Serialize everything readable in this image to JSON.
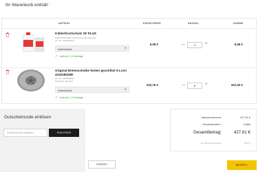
{
  "page": {
    "title": "Ihr Warenkorb enthält :"
  },
  "table": {
    "headers": {
      "artikel": "ARTIKEL",
      "einzelpreis": "EINZELPREIS",
      "anzahl": "ANZAHL",
      "summe": "SUMME"
    }
  },
  "items": [
    {
      "name": "Kühlerfrostschutz SF PLUS",
      "meta1": "Kühlerfrostschutz SF PLUS (1,5ltr-Flasche)",
      "meta2": "Art.-Nr.: SF00374A1",
      "attributes_label": "Artikeldetails",
      "stock": "Lieferzeit: 1-2 Werktage",
      "unit_price": "6,09 €",
      "quantity": "1",
      "total": "6,09 €"
    },
    {
      "name": "Original Bremsscheibe hinten geschlitzt 5-Loch 432028026R",
      "meta1": "Art.-Nr.: SF0003A01",
      "meta2": "Hersteller: Renault",
      "attributes_label": "Artikeldetails",
      "stock": "Lieferzeit: 1-2 Werktage",
      "unit_price": "210,76 €",
      "quantity": "2",
      "total": "421,52 €"
    }
  ],
  "voucher": {
    "title": "Gutscheincode einlösen",
    "placeholder": "Gutscheincode eingeben",
    "button": "EINLÖSEN"
  },
  "summary": {
    "subtotal_label": "Zwischensumme:",
    "subtotal": "427,61 €",
    "shipping_label": "Versandkosten*:",
    "shipping": "Gratis",
    "grand_label": "Gesamtbetrag:",
    "grand": "427,61 €",
    "vat_label": "inkl. 19% Mehrwertsteuer",
    "vat": "68,27 €"
  },
  "buttons": {
    "back": "ZURÜCK",
    "next": "WEITER »"
  },
  "colors": {
    "accent": "#f3c400",
    "trash": "#d9534f",
    "stock_ok": "#3c9a3c"
  }
}
